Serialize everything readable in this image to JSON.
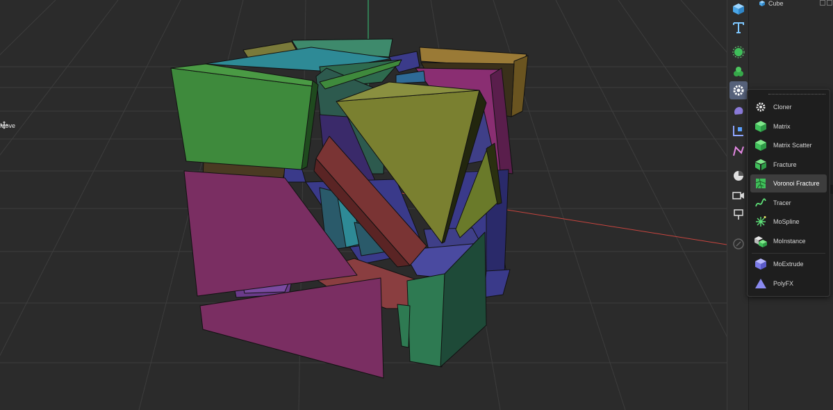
{
  "viewport": {
    "hud": {
      "move_label": "Move"
    }
  },
  "toolbar": {
    "buttons": [
      {
        "id": "cube",
        "icon": "cube-icon",
        "active": false
      },
      {
        "id": "text",
        "icon": "text-icon",
        "active": false
      },
      {
        "id": "generators",
        "icon": "generator-icon",
        "active": false
      },
      {
        "id": "volume",
        "icon": "volume-icon",
        "active": false
      },
      {
        "id": "mograph",
        "icon": "mograph-gear-icon",
        "active": true
      },
      {
        "id": "deformer",
        "icon": "deformer-icon",
        "active": false
      },
      {
        "id": "field",
        "icon": "field-icon",
        "active": false
      },
      {
        "id": "spline",
        "icon": "spline-pen-icon",
        "active": false
      },
      {
        "id": "environment",
        "icon": "environment-icon",
        "active": false
      },
      {
        "id": "camera",
        "icon": "camera-icon",
        "active": false
      },
      {
        "id": "light",
        "icon": "light-icon",
        "active": false
      },
      {
        "id": "sculpt",
        "icon": "sculpt-icon",
        "active": false
      }
    ]
  },
  "object_manager": {
    "objects": [
      {
        "name": "Cube",
        "icon": "cube-icon"
      }
    ]
  },
  "mograph_menu": {
    "items": [
      {
        "label": "Cloner",
        "icon": "cloner-icon",
        "highlighted": false
      },
      {
        "label": "Matrix",
        "icon": "matrix-icon",
        "highlighted": false
      },
      {
        "label": "Matrix Scatter",
        "icon": "matrix-scatter-icon",
        "highlighted": false
      },
      {
        "label": "Fracture",
        "icon": "fracture-icon",
        "highlighted": false
      },
      {
        "label": "Voronoi Fracture",
        "icon": "voronoi-fracture-icon",
        "highlighted": true
      },
      {
        "label": "Tracer",
        "icon": "tracer-icon",
        "highlighted": false
      },
      {
        "label": "MoSpline",
        "icon": "mospline-icon",
        "highlighted": false
      },
      {
        "label": "MoInstance",
        "icon": "moinstance-icon",
        "highlighted": false
      },
      {
        "label": "MoExtrude",
        "icon": "moextrude-icon",
        "highlighted": false
      },
      {
        "label": "PolyFX",
        "icon": "polyfx-icon",
        "highlighted": false
      }
    ]
  },
  "colors": {
    "accent": "#56617a",
    "menu_bg": "#1e1e1e",
    "viewport_bg": "#2b2b2b",
    "y_axis": "#39c77a",
    "x_axis": "#c9453f"
  }
}
